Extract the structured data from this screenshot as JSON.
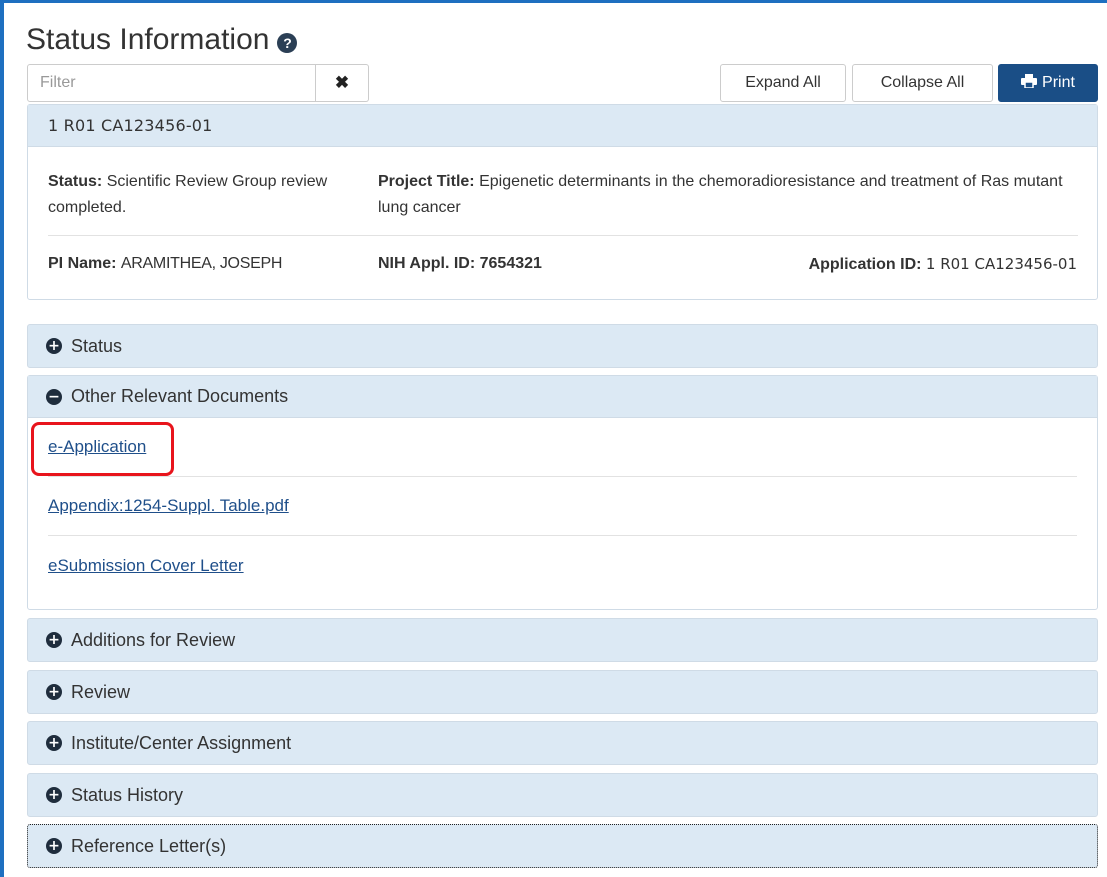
{
  "page": {
    "title": "Status Information",
    "help_icon": "question-circle-icon"
  },
  "toolbar": {
    "filter_placeholder": "Filter",
    "filter_value": "",
    "clear_icon": "times-icon",
    "clear_glyph": "✖",
    "expand_all": "Expand All",
    "collapse_all": "Collapse All",
    "print": "Print",
    "print_icon": "print-icon"
  },
  "summary": {
    "header": "1 R01 CA123456-01",
    "status_label": "Status:",
    "status_value": "Scientific Review Group review completed.",
    "project_title_label": "Project Title:",
    "project_title_value": "Epigenetic determinants in the chemoradioresistance and treatment of Ras mutant lung cancer",
    "pi_label": "PI Name:",
    "pi_value": "ARAMITHEA, JOSEPH",
    "nih_label": "NIH Appl. ID:",
    "nih_value": "7654321",
    "appid_label": "Application ID:",
    "appid_value": "1 R01 CA123456-01"
  },
  "panels": [
    {
      "label": "Status",
      "state": "collapsed",
      "icon": "plus-circle-icon"
    },
    {
      "label": "Other Relevant Documents",
      "state": "expanded",
      "icon": "minus-circle-icon",
      "links": [
        "e-Application",
        "Appendix:1254-Suppl. Table.pdf",
        "eSubmission Cover Letter"
      ]
    },
    {
      "label": "Additions for Review",
      "state": "collapsed",
      "icon": "plus-circle-icon"
    },
    {
      "label": "Review",
      "state": "collapsed",
      "icon": "plus-circle-icon"
    },
    {
      "label": "Institute/Center Assignment",
      "state": "collapsed",
      "icon": "plus-circle-icon"
    },
    {
      "label": "Status History",
      "state": "collapsed",
      "icon": "plus-circle-icon"
    },
    {
      "label": "Reference Letter(s)",
      "state": "collapsed",
      "icon": "plus-circle-icon"
    }
  ],
  "glyphs": {
    "plus": "+",
    "minus": "−",
    "help": "?"
  },
  "colors": {
    "accent_border": "#1e6fc0",
    "panel_bg": "#dce9f4",
    "print_button": "#1a4e86",
    "link": "#1f4f8a",
    "highlight": "#e8141c"
  }
}
